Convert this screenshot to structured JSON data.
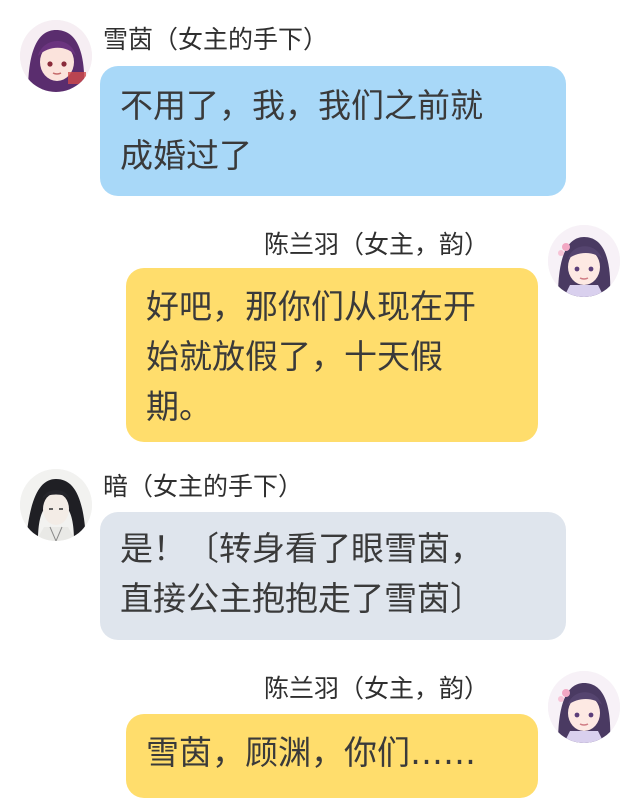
{
  "messages": [
    {
      "sender": "雪茵（女主的手下）",
      "side": "left",
      "avatar_icon": "purple-hair-girl-avatar-icon",
      "bubble_color": "#a8d8f8",
      "lines": [
        "不用了，我，我们之前就",
        "成婚过了"
      ]
    },
    {
      "sender": "陈兰羽（女主，韵）",
      "side": "right",
      "avatar_icon": "flower-hair-girl-avatar-icon",
      "bubble_color": "#ffdd6c",
      "lines": [
        "好吧，那你们从现在开",
        "始就放假了，十天假",
        "期。"
      ]
    },
    {
      "sender": "暗（女主的手下）",
      "side": "left",
      "avatar_icon": "long-black-hair-man-avatar-icon",
      "bubble_color": "#dfe5ed",
      "lines": [
        "是！〔转身看了眼雪茵，",
        "直接公主抱抱走了雪茵〕"
      ]
    },
    {
      "sender": "陈兰羽（女主，韵）",
      "side": "right",
      "avatar_icon": "flower-hair-girl-avatar-icon",
      "bubble_color": "#ffdd6c",
      "lines": [
        "雪茵，顾渊，你们……"
      ]
    }
  ]
}
